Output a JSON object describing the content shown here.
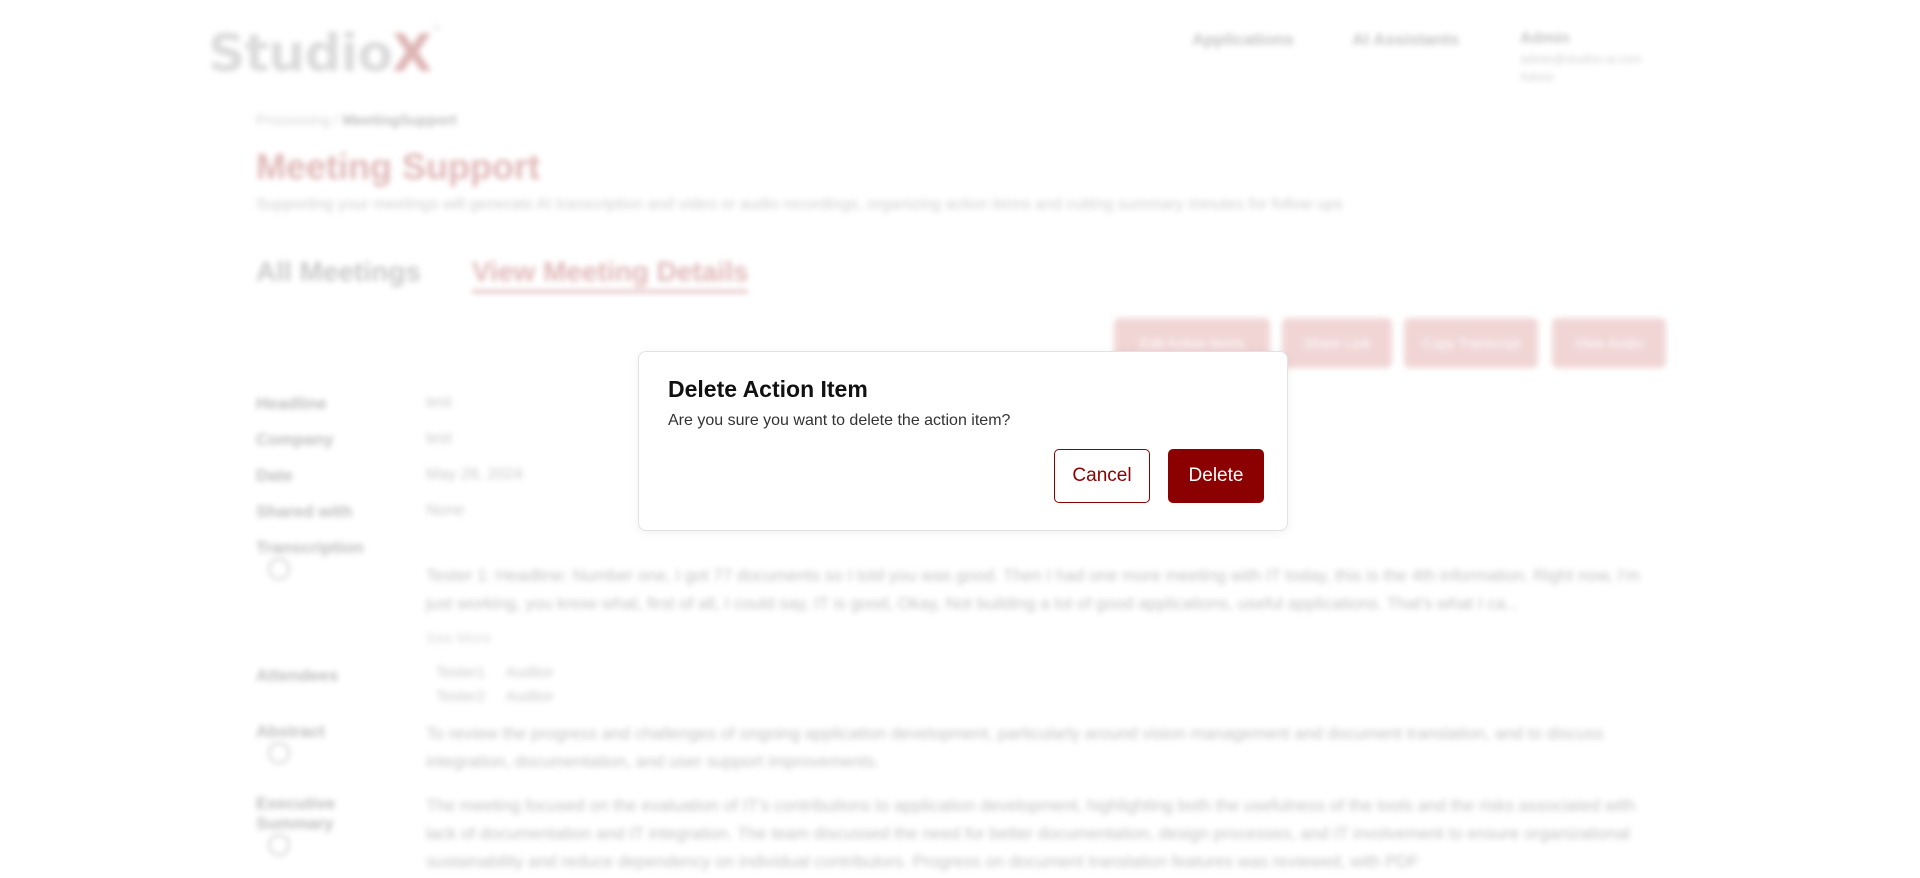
{
  "app": {
    "logo_text": "Studio",
    "logo_x": "X",
    "logo_mark": "™"
  },
  "nav": {
    "items": [
      "Applications",
      "AI Assistants"
    ]
  },
  "user": {
    "name": "Admin",
    "email": "admin@studiox.ai.com",
    "role": "Admin"
  },
  "breadcrumb": {
    "root": "Processing",
    "sep": "/",
    "current": "MeetingSupport"
  },
  "page": {
    "title": "Meeting Support",
    "description": "Supporting your meetings will generate AI transcription and video or audio recordings, organizing action items and cutting summary minutes for follow ups"
  },
  "tabs": [
    {
      "label": "All Meetings",
      "active": false
    },
    {
      "label": "View Meeting Details",
      "active": true
    }
  ],
  "actions": [
    "Edit Action Items",
    "Share Link",
    "Copy Transcript",
    "View Audio"
  ],
  "details": {
    "headline": {
      "label": "Headline",
      "value": "test"
    },
    "company": {
      "label": "Company",
      "value": "test"
    },
    "date": {
      "label": "Date",
      "value": "May 28, 2024"
    },
    "shared_with": {
      "label": "Shared with",
      "value": "None"
    },
    "transcription": {
      "label": "Transcription",
      "text": "Tester 1: Headline: Number one, I got 77 documents so I told you was good. Then I had one more meeting with IT today, this is the 4th information. Right now, I'm just working, you know what, first of all, I could say, IT is good, Okay, Not building a lot of good applications, useful applications. That's what I ca...",
      "see_more": "See More"
    },
    "attendees": {
      "label": "Attendees",
      "rows": [
        [
          "Tester1",
          "Auditor"
        ],
        [
          "Tester2",
          "Auditor"
        ]
      ]
    },
    "abstract": {
      "label": "Abstract",
      "text": "To review the progress and challenges of ongoing application development, particularly around vision management and document translation, and to discuss integration, documentation, and user support improvements."
    },
    "executive_summary": {
      "label": "Executive Summary",
      "text": "The meeting focused on the evaluation of IT's contributions to application development, highlighting both the usefulness of the tools and the risks associated with lack of documentation and IT integration. The team discussed the need for better documentation, design processes, and IT involvement to ensure organizational sustainability and reduce dependency on individual contributors. Progress on document translation features was reviewed, with PDF"
    }
  },
  "dialog": {
    "title": "Delete Action Item",
    "message": "Are you sure you want to delete the action item?",
    "cancel_label": "Cancel",
    "delete_label": "Delete"
  },
  "colors": {
    "accent": "#8b0000",
    "brand": "#a93434"
  }
}
